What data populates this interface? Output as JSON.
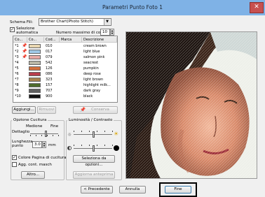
{
  "window": {
    "title": "Parametri Punto Foto 1",
    "close_glyph": "✕"
  },
  "schema": {
    "label": "Schema Fili:",
    "value": "Brother Chart(Photo Stitch)"
  },
  "selection": {
    "label_line1": "Selezione",
    "label_line2": "automatica",
    "checked": true
  },
  "max_colors": {
    "label": "Numero massimo di colori",
    "value": "10"
  },
  "table": {
    "headers": [
      "Co...",
      "Co...",
      "Cod...",
      "Marca",
      "Descrizione"
    ],
    "rows": [
      {
        "num": "*1",
        "pin": true,
        "color": "#e8d6b0",
        "code": "010",
        "desc": "cream brown"
      },
      {
        "num": "*2",
        "pin": true,
        "color": "#9fc8e6",
        "code": "017",
        "desc": "light blue"
      },
      {
        "num": "*3",
        "pin": true,
        "color": "#e7a9a4",
        "code": "079",
        "desc": "salmon pink"
      },
      {
        "num": "*4",
        "pin": false,
        "color": "#b9b6a6",
        "code": "542",
        "desc": "seacrest"
      },
      {
        "num": "*5",
        "pin": false,
        "color": "#d3703c",
        "code": "126",
        "desc": "pumpkin"
      },
      {
        "num": "*6",
        "pin": false,
        "color": "#b83d4c",
        "code": "086",
        "desc": "deep rose"
      },
      {
        "num": "*7",
        "pin": false,
        "color": "#a8824f",
        "code": "323",
        "desc": "light brown"
      },
      {
        "num": "*8",
        "pin": false,
        "color": "#4e6b2c",
        "code": "157",
        "desc": "highlight milk..."
      },
      {
        "num": "*9",
        "pin": false,
        "color": "#5f5f5f",
        "code": "707",
        "desc": "dark gray"
      },
      {
        "num": "*10",
        "pin": false,
        "color": "#111111",
        "code": "900",
        "desc": "black"
      }
    ]
  },
  "buttons": {
    "add": "Aggiungi...",
    "remove": "Rimuovi",
    "keep": "Conserva",
    "colors": "Seleziona da opzioni...",
    "preview": "Aggiorna anteprima",
    "other": "Altro...",
    "back": "< Precedente",
    "cancel": "Annulla",
    "finish": "Fine"
  },
  "stitch_options": {
    "title": "Opzione Cucitura",
    "medium": "Medione",
    "fine": "Fine",
    "detail": "Dettaglio",
    "length_label1": "Lunghezza",
    "length_label2": "punto",
    "length_value": "3.0",
    "unit": "mm",
    "color_page_label": "Colore Pagina di cucitura",
    "color_page_checked": true,
    "add_contour_label": "Agg. cont. masch",
    "add_contour_checked": false,
    "detail_level": 0.55
  },
  "brightness": {
    "title": "Luminosità / Contrasto",
    "brightness_level": 0.5,
    "contrast_level": 0.5
  },
  "icons": {
    "pin": "pin-icon",
    "sun_low": "sun-low-icon",
    "sun_high": "sun-high-icon",
    "contrast_low": "contrast-low-icon",
    "contrast_high": "contrast-high-icon"
  }
}
